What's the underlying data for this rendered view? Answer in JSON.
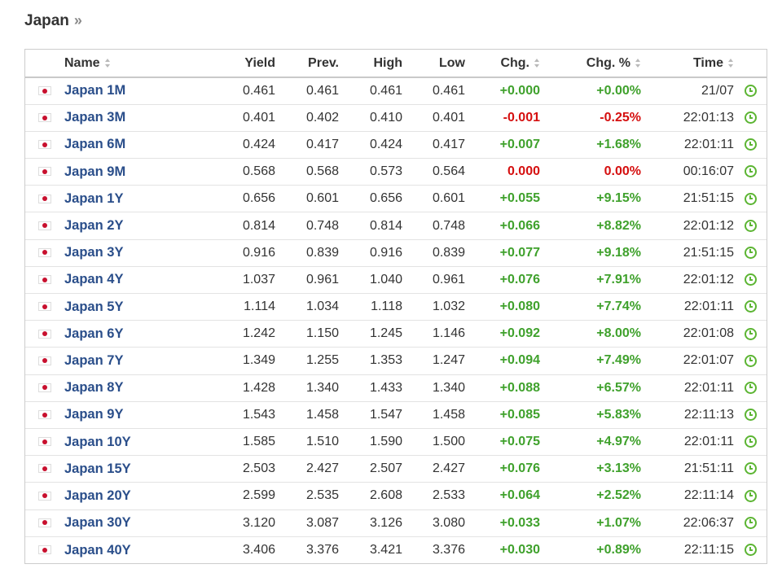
{
  "page": {
    "title": "Japan",
    "title_arrows": "»"
  },
  "columns": {
    "name": "Name",
    "yield": "Yield",
    "prev": "Prev.",
    "high": "High",
    "low": "Low",
    "chg": "Chg.",
    "chg_pct": "Chg. %",
    "time": "Time"
  },
  "colors": {
    "positive": "#3fa12c",
    "negative": "#d50f0f",
    "link": "#2a4e8a",
    "clock": "#5cb533"
  },
  "icons": {
    "flag": "japan-flag-icon",
    "clock": "clock-icon",
    "sort": "sort-arrows-icon"
  },
  "rows": [
    {
      "name": "Japan 1M",
      "yield": "0.461",
      "prev": "0.461",
      "high": "0.461",
      "low": "0.461",
      "chg": "+0.000",
      "chg_pct": "+0.00%",
      "time": "21/07",
      "dir": "pos"
    },
    {
      "name": "Japan 3M",
      "yield": "0.401",
      "prev": "0.402",
      "high": "0.410",
      "low": "0.401",
      "chg": "-0.001",
      "chg_pct": "-0.25%",
      "time": "22:01:13",
      "dir": "neg"
    },
    {
      "name": "Japan 6M",
      "yield": "0.424",
      "prev": "0.417",
      "high": "0.424",
      "low": "0.417",
      "chg": "+0.007",
      "chg_pct": "+1.68%",
      "time": "22:01:11",
      "dir": "pos"
    },
    {
      "name": "Japan 9M",
      "yield": "0.568",
      "prev": "0.568",
      "high": "0.573",
      "low": "0.564",
      "chg": "0.000",
      "chg_pct": "0.00%",
      "time": "00:16:07",
      "dir": "neg"
    },
    {
      "name": "Japan 1Y",
      "yield": "0.656",
      "prev": "0.601",
      "high": "0.656",
      "low": "0.601",
      "chg": "+0.055",
      "chg_pct": "+9.15%",
      "time": "21:51:15",
      "dir": "pos"
    },
    {
      "name": "Japan 2Y",
      "yield": "0.814",
      "prev": "0.748",
      "high": "0.814",
      "low": "0.748",
      "chg": "+0.066",
      "chg_pct": "+8.82%",
      "time": "22:01:12",
      "dir": "pos"
    },
    {
      "name": "Japan 3Y",
      "yield": "0.916",
      "prev": "0.839",
      "high": "0.916",
      "low": "0.839",
      "chg": "+0.077",
      "chg_pct": "+9.18%",
      "time": "21:51:15",
      "dir": "pos"
    },
    {
      "name": "Japan 4Y",
      "yield": "1.037",
      "prev": "0.961",
      "high": "1.040",
      "low": "0.961",
      "chg": "+0.076",
      "chg_pct": "+7.91%",
      "time": "22:01:12",
      "dir": "pos"
    },
    {
      "name": "Japan 5Y",
      "yield": "1.114",
      "prev": "1.034",
      "high": "1.118",
      "low": "1.032",
      "chg": "+0.080",
      "chg_pct": "+7.74%",
      "time": "22:01:11",
      "dir": "pos"
    },
    {
      "name": "Japan 6Y",
      "yield": "1.242",
      "prev": "1.150",
      "high": "1.245",
      "low": "1.146",
      "chg": "+0.092",
      "chg_pct": "+8.00%",
      "time": "22:01:08",
      "dir": "pos"
    },
    {
      "name": "Japan 7Y",
      "yield": "1.349",
      "prev": "1.255",
      "high": "1.353",
      "low": "1.247",
      "chg": "+0.094",
      "chg_pct": "+7.49%",
      "time": "22:01:07",
      "dir": "pos"
    },
    {
      "name": "Japan 8Y",
      "yield": "1.428",
      "prev": "1.340",
      "high": "1.433",
      "low": "1.340",
      "chg": "+0.088",
      "chg_pct": "+6.57%",
      "time": "22:01:11",
      "dir": "pos"
    },
    {
      "name": "Japan 9Y",
      "yield": "1.543",
      "prev": "1.458",
      "high": "1.547",
      "low": "1.458",
      "chg": "+0.085",
      "chg_pct": "+5.83%",
      "time": "22:11:13",
      "dir": "pos"
    },
    {
      "name": "Japan 10Y",
      "yield": "1.585",
      "prev": "1.510",
      "high": "1.590",
      "low": "1.500",
      "chg": "+0.075",
      "chg_pct": "+4.97%",
      "time": "22:01:11",
      "dir": "pos"
    },
    {
      "name": "Japan 15Y",
      "yield": "2.503",
      "prev": "2.427",
      "high": "2.507",
      "low": "2.427",
      "chg": "+0.076",
      "chg_pct": "+3.13%",
      "time": "21:51:11",
      "dir": "pos"
    },
    {
      "name": "Japan 20Y",
      "yield": "2.599",
      "prev": "2.535",
      "high": "2.608",
      "low": "2.533",
      "chg": "+0.064",
      "chg_pct": "+2.52%",
      "time": "22:11:14",
      "dir": "pos"
    },
    {
      "name": "Japan 30Y",
      "yield": "3.120",
      "prev": "3.087",
      "high": "3.126",
      "low": "3.080",
      "chg": "+0.033",
      "chg_pct": "+1.07%",
      "time": "22:06:37",
      "dir": "pos"
    },
    {
      "name": "Japan 40Y",
      "yield": "3.406",
      "prev": "3.376",
      "high": "3.421",
      "low": "3.376",
      "chg": "+0.030",
      "chg_pct": "+0.89%",
      "time": "22:11:15",
      "dir": "pos"
    }
  ]
}
